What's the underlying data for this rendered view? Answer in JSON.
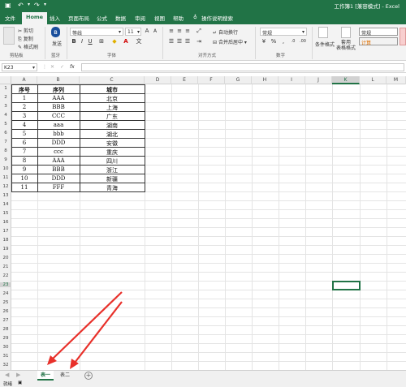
{
  "title_bar": {
    "title": "工作簿1  [兼容模式]  -  Excel"
  },
  "tabs": [
    "文件",
    "Home",
    "插入",
    "页面布局",
    "公式",
    "数据",
    "审阅",
    "视图",
    "帮助",
    "操作说明搜索"
  ],
  "ribbon": {
    "clipboard": {
      "cut": "剪切",
      "copy": "复制",
      "format_painter": "格式刷",
      "group": "剪贴板"
    },
    "bluetooth": {
      "label": "发送",
      "group": "蓝牙"
    },
    "font": {
      "name": "等线",
      "size": "11",
      "group": "字体"
    },
    "alignment": {
      "wrap": "自动换行",
      "merge": "合并后居中",
      "group": "对齐方式"
    },
    "number": {
      "format": "常规",
      "group": "数字"
    },
    "styles": {
      "conditional": "条件格式",
      "table": "套用\n表格格式",
      "style_normal": "常规",
      "style_calc": "计算"
    }
  },
  "formula_bar": {
    "name_box": "K23",
    "fx": "fx",
    "value": ""
  },
  "columns": [
    "A",
    "B",
    "C",
    "D",
    "E",
    "F",
    "G",
    "H",
    "I",
    "J",
    "K",
    "L",
    "M"
  ],
  "rows": [
    "1",
    "2",
    "3",
    "4",
    "5",
    "6",
    "7",
    "8",
    "9",
    "10",
    "11",
    "12",
    "13",
    "14",
    "15",
    "16",
    "17",
    "18",
    "19",
    "20",
    "21",
    "22",
    "23",
    "24",
    "25",
    "26",
    "27",
    "28",
    "29",
    "30",
    "31",
    "32"
  ],
  "table": {
    "headers": [
      "序号",
      "序列",
      "城市"
    ],
    "rows": [
      [
        "1",
        "AAA",
        "北京"
      ],
      [
        "2",
        "BBB",
        "上海"
      ],
      [
        "3",
        "CCC",
        "广东"
      ],
      [
        "4",
        "aaa",
        "湖南"
      ],
      [
        "5",
        "bbb",
        "湖北"
      ],
      [
        "6",
        "DDD",
        "安徽"
      ],
      [
        "7",
        "ccc",
        "重庆"
      ],
      [
        "8",
        "AAA",
        "四川"
      ],
      [
        "9",
        "BBB",
        "浙江"
      ],
      [
        "10",
        "DDD",
        "新疆"
      ],
      [
        "11",
        "FFF",
        "青海"
      ]
    ]
  },
  "sheets": [
    {
      "name": "表一",
      "active": true
    },
    {
      "name": "表二",
      "active": false
    }
  ],
  "status": {
    "ready": "就绪"
  },
  "colors": {
    "excel_green": "#217346",
    "arrow_red": "#e8302a"
  }
}
